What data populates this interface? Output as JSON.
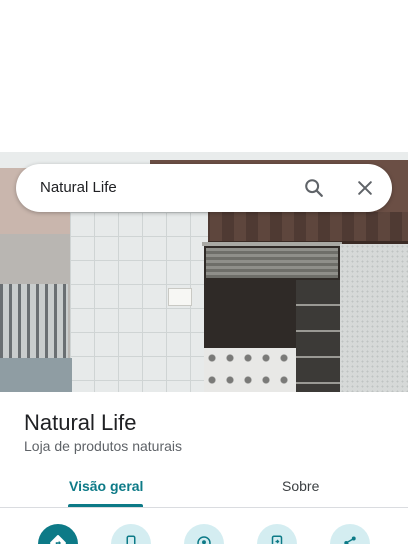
{
  "search": {
    "query": "Natural Life",
    "search_icon": "search-icon",
    "close_icon": "close-icon"
  },
  "place": {
    "name": "Natural Life",
    "category": "Loja de produtos naturais"
  },
  "tabs": [
    {
      "label": "Visão geral",
      "active": true
    },
    {
      "label": "Sobre",
      "active": false
    }
  ],
  "actions": [
    {
      "icon": "directions-icon",
      "primary": true
    },
    {
      "icon": "phone-icon",
      "primary": false
    },
    {
      "icon": "location-icon",
      "primary": false
    },
    {
      "icon": "send-to-phone-icon",
      "primary": false
    },
    {
      "icon": "share-icon",
      "primary": false
    }
  ],
  "colors": {
    "accent": "#0d7a87",
    "action_bg": "#d4edf1",
    "text_primary": "#202124",
    "text_secondary": "#5f6368"
  }
}
